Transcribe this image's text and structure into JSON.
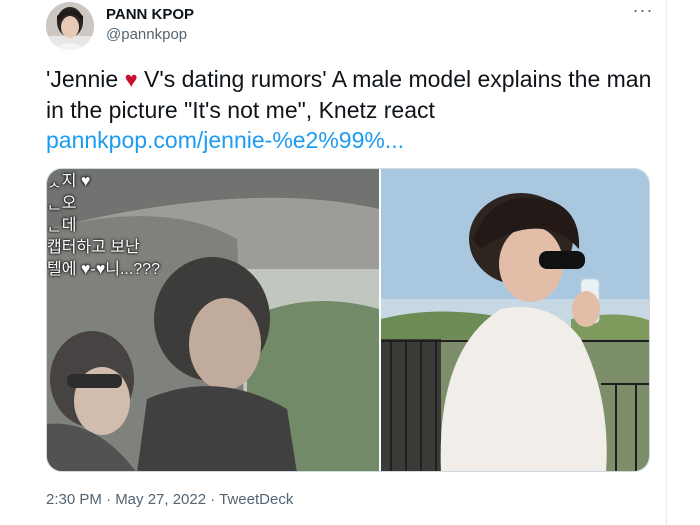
{
  "tweet": {
    "author_name": "PANN KPOP",
    "author_handle": "@pannkpop",
    "text_before_heart": "'Jennie ",
    "text_after_heart": " V's dating rumors' A male model explains the man in the picture \"It's not me\", Knetz react",
    "link": "pannkpop.com/jennie-%e2%99%...",
    "heart_glyph": "♥",
    "more_glyph": "···",
    "korean_caption_lines": [
      "ᆺ지 ♥",
      "ᆫ오",
      "ᆫ데",
      "캡터하고 보난",
      "텔에 ♥-♥니...???"
    ],
    "timestamp": "2:30 PM · May 27, 2022 · TweetDeck"
  },
  "colors": {
    "link": "#1d9bf0",
    "heart": "#c8102e",
    "secondary_text": "#536471",
    "border": "#cfd9de"
  },
  "icons": {
    "avatar": "avatar-photo",
    "more": "more-options-icon",
    "heart": "heart-icon"
  }
}
